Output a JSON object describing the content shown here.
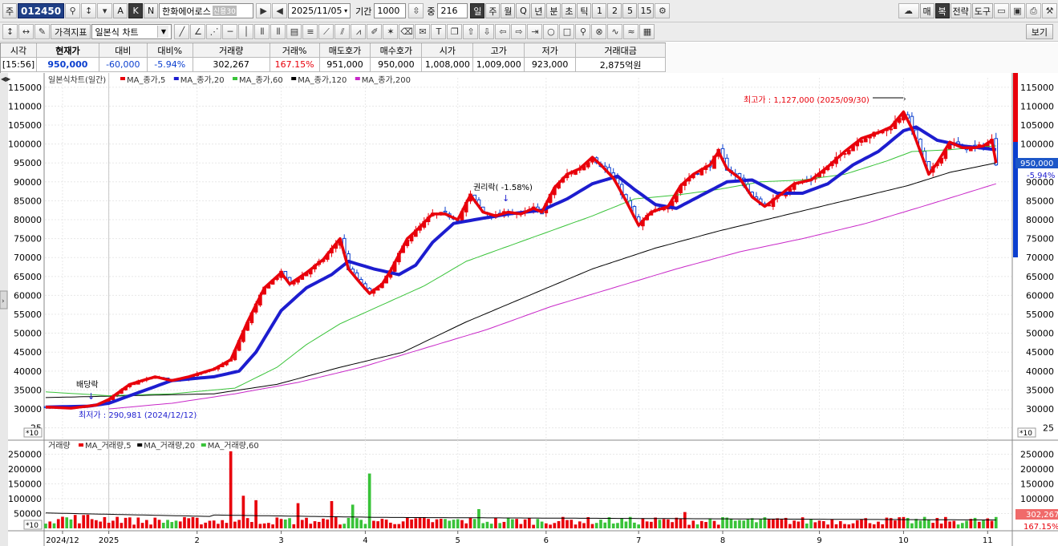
{
  "toolbar": {
    "market_label": "주",
    "stock_code": "012450",
    "stock_name": "한화에어로스",
    "name_tag": "신용30",
    "date": "2025/11/05",
    "period_label": "기간",
    "period_value": "1000",
    "view_label": "중",
    "view_value": "216",
    "range_buttons": [
      "일",
      "주",
      "월",
      "Q",
      "년",
      "분",
      "초",
      "틱",
      "1",
      "2",
      "5",
      "15"
    ],
    "range_selected": "일",
    "right_buttons": [
      "매",
      "복",
      "전략",
      "도구"
    ],
    "ak_buttons": [
      "A",
      "K",
      "N"
    ]
  },
  "toolbar2": {
    "price_indicator_btn": "가격지표",
    "chart_type": "일본식 차트",
    "view_btn": "보기"
  },
  "quote": {
    "headers": [
      "시각",
      "현재가",
      "대비",
      "대비%",
      "거래량",
      "거래%",
      "매도호가",
      "매수호가",
      "시가",
      "고가",
      "저가",
      "거래대금"
    ],
    "values": [
      "[15:56]",
      "950,000",
      "-60,000",
      "-5.94%",
      "302,267",
      "167.15%",
      "951,000",
      "950,000",
      "1,008,000",
      "1,009,000",
      "923,000",
      "2,875억원"
    ]
  },
  "colors": {
    "up": "#e8000b",
    "down": "#0b3fcf",
    "ma5": "#e8000b",
    "ma20": "#1d1dcf",
    "ma60": "#39c339",
    "ma120": "#000000",
    "ma200": "#c828c8",
    "vol_up": "#e8000b",
    "vol_down": "#39c339"
  },
  "chart_data": [
    {
      "type": "line",
      "title": "일본식차트(일간)",
      "legend": [
        "MA_종가,5",
        "MA_종가,20",
        "MA_종가,60",
        "MA_종가,120",
        "MA_종가,200"
      ],
      "y_ticks": [
        25000,
        30000,
        35000,
        40000,
        45000,
        50000,
        55000,
        60000,
        65000,
        70000,
        75000,
        80000,
        85000,
        90000,
        95000,
        100000,
        105000,
        110000,
        115000
      ],
      "y_ticks_text": [
        "25",
        "30000",
        "35000",
        "40000",
        "45000",
        "50000",
        "55000",
        "60000",
        "65000",
        "70000",
        "75000",
        "80000",
        "85000",
        "90000",
        "95000",
        "100000",
        "105000",
        "110000",
        "115000"
      ],
      "y_unit": "*10",
      "ylim": [
        24500,
        117500
      ],
      "x_ticks": [
        "2024/12",
        "2025",
        "2",
        "3",
        "4",
        "5",
        "6",
        "7",
        "8",
        "9",
        "10",
        "11"
      ],
      "x_tick_days": [
        4,
        15,
        36,
        56,
        76,
        98,
        119,
        141,
        161,
        184,
        204,
        224
      ],
      "days": 227,
      "close_series": [
        [
          0,
          30500
        ],
        [
          6,
          30200
        ],
        [
          12,
          31000
        ],
        [
          15,
          32500
        ],
        [
          20,
          36500
        ],
        [
          26,
          38500
        ],
        [
          30,
          37500
        ],
        [
          34,
          38500
        ],
        [
          40,
          40500
        ],
        [
          44,
          43000
        ],
        [
          48,
          53000
        ],
        [
          52,
          62000
        ],
        [
          56,
          66000
        ],
        [
          58,
          63000
        ],
        [
          62,
          66000
        ],
        [
          66,
          69500
        ],
        [
          70,
          75000
        ],
        [
          72,
          67000
        ],
        [
          75,
          63000
        ],
        [
          77,
          60500
        ],
        [
          80,
          63000
        ],
        [
          82,
          66500
        ],
        [
          86,
          75000
        ],
        [
          88,
          77000
        ],
        [
          92,
          81500
        ],
        [
          95,
          81500
        ],
        [
          98,
          80000
        ],
        [
          101,
          86500
        ],
        [
          104,
          82000
        ],
        [
          107,
          81000
        ],
        [
          110,
          82000
        ],
        [
          113,
          81500
        ],
        [
          116,
          83000
        ],
        [
          118,
          82000
        ],
        [
          121,
          88500
        ],
        [
          124,
          92000
        ],
        [
          127,
          93500
        ],
        [
          130,
          96500
        ],
        [
          132,
          94500
        ],
        [
          135,
          91000
        ],
        [
          138,
          85000
        ],
        [
          141,
          78500
        ],
        [
          144,
          82000
        ],
        [
          148,
          83500
        ],
        [
          151,
          89000
        ],
        [
          154,
          92000
        ],
        [
          158,
          94500
        ],
        [
          160,
          98000
        ],
        [
          162,
          93500
        ],
        [
          165,
          91000
        ],
        [
          168,
          86000
        ],
        [
          171,
          83500
        ],
        [
          174,
          86000
        ],
        [
          178,
          89500
        ],
        [
          182,
          90500
        ],
        [
          186,
          94000
        ],
        [
          190,
          98000
        ],
        [
          194,
          101500
        ],
        [
          198,
          103000
        ],
        [
          201,
          104500
        ],
        [
          204,
          108500
        ],
        [
          206,
          104000
        ],
        [
          208,
          98000
        ],
        [
          210,
          92000
        ],
        [
          212,
          95000
        ],
        [
          215,
          100500
        ],
        [
          218,
          99000
        ],
        [
          221,
          99000
        ],
        [
          223,
          99500
        ],
        [
          225,
          101000
        ],
        [
          226,
          95000
        ]
      ],
      "ma20_series": [
        [
          0,
          30500
        ],
        [
          10,
          30700
        ],
        [
          15,
          31500
        ],
        [
          20,
          33500
        ],
        [
          30,
          37500
        ],
        [
          40,
          38500
        ],
        [
          46,
          40000
        ],
        [
          50,
          45000
        ],
        [
          56,
          56000
        ],
        [
          62,
          62000
        ],
        [
          68,
          65500
        ],
        [
          72,
          69000
        ],
        [
          78,
          67000
        ],
        [
          84,
          65500
        ],
        [
          88,
          68000
        ],
        [
          92,
          74000
        ],
        [
          97,
          79000
        ],
        [
          102,
          80000
        ],
        [
          110,
          81500
        ],
        [
          118,
          82500
        ],
        [
          124,
          85500
        ],
        [
          130,
          89500
        ],
        [
          136,
          91500
        ],
        [
          140,
          88000
        ],
        [
          145,
          84000
        ],
        [
          150,
          83000
        ],
        [
          156,
          86500
        ],
        [
          162,
          90000
        ],
        [
          168,
          90500
        ],
        [
          174,
          87000
        ],
        [
          180,
          87000
        ],
        [
          186,
          89500
        ],
        [
          192,
          94500
        ],
        [
          198,
          98000
        ],
        [
          204,
          103500
        ],
        [
          207,
          104500
        ],
        [
          212,
          101000
        ],
        [
          218,
          99500
        ],
        [
          226,
          98500
        ]
      ],
      "ma60_series": [
        [
          0,
          34500
        ],
        [
          15,
          33500
        ],
        [
          30,
          34000
        ],
        [
          45,
          35500
        ],
        [
          55,
          41000
        ],
        [
          62,
          47000
        ],
        [
          70,
          52500
        ],
        [
          80,
          57500
        ],
        [
          90,
          62500
        ],
        [
          100,
          69000
        ],
        [
          110,
          73000
        ],
        [
          120,
          77000
        ],
        [
          130,
          81000
        ],
        [
          140,
          85500
        ],
        [
          150,
          86500
        ],
        [
          160,
          88000
        ],
        [
          170,
          90000
        ],
        [
          180,
          90500
        ],
        [
          190,
          92000
        ],
        [
          200,
          95500
        ],
        [
          206,
          98000
        ],
        [
          215,
          98500
        ],
        [
          226,
          99500
        ]
      ],
      "ma120_series": [
        [
          0,
          33000
        ],
        [
          20,
          33500
        ],
        [
          40,
          34000
        ],
        [
          55,
          36500
        ],
        [
          70,
          41000
        ],
        [
          85,
          45000
        ],
        [
          100,
          53000
        ],
        [
          115,
          60000
        ],
        [
          130,
          67000
        ],
        [
          145,
          72500
        ],
        [
          160,
          77000
        ],
        [
          175,
          81000
        ],
        [
          190,
          85000
        ],
        [
          205,
          89000
        ],
        [
          215,
          92500
        ],
        [
          226,
          95000
        ]
      ],
      "ma200_series": [
        [
          15,
          30000
        ],
        [
          30,
          31500
        ],
        [
          45,
          34000
        ],
        [
          60,
          37000
        ],
        [
          75,
          41000
        ],
        [
          90,
          46000
        ],
        [
          105,
          51000
        ],
        [
          120,
          57000
        ],
        [
          135,
          62000
        ],
        [
          150,
          67000
        ],
        [
          165,
          71500
        ],
        [
          180,
          75000
        ],
        [
          195,
          79000
        ],
        [
          210,
          84000
        ],
        [
          226,
          89500
        ]
      ],
      "annotations": {
        "high": "최고가 : 1,127,000 (2025/09/30)",
        "low": "최저가 : 290,981 (2024/12/12)",
        "dividend": "배당락",
        "rights": "권리락( -1.58%)"
      },
      "right_labels": {
        "price": "950,000",
        "change_pct": "-5.94%"
      }
    },
    {
      "type": "bar",
      "title": "거래량",
      "legend": [
        "MA_거래량,5",
        "MA_거래량,20",
        "MA_거래량,60"
      ],
      "y_ticks": [
        50000,
        100000,
        150000,
        200000,
        250000
      ],
      "y_ticks_text": [
        "50000",
        "100000",
        "150000",
        "200000",
        "250000"
      ],
      "y_unit": "*10",
      "ylim": [
        0,
        265000
      ],
      "spikes": [
        [
          44,
          260000
        ],
        [
          47,
          110000
        ],
        [
          50,
          95000
        ],
        [
          60,
          85000
        ],
        [
          68,
          92000
        ],
        [
          73,
          80000
        ],
        [
          77,
          185000
        ],
        [
          103,
          65000
        ],
        [
          152,
          55000
        ],
        [
          210,
          30000
        ]
      ],
      "base_volume": 30000,
      "right_labels": {
        "volume": "302,267",
        "volume_pct": "167.15%"
      }
    }
  ]
}
